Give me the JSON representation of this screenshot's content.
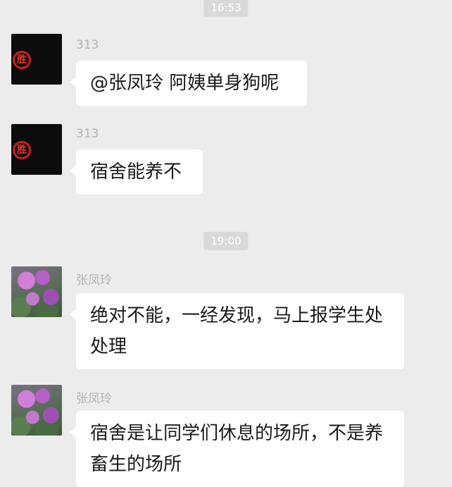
{
  "timestamps": [
    "16:53",
    "19:00"
  ],
  "messages": [
    {
      "sender": "313",
      "text": "@张凤玲 阿姨单身狗呢",
      "avatar": "seal-avatar"
    },
    {
      "sender": "313",
      "text": "宿舍能养不",
      "avatar": "seal-avatar"
    },
    {
      "sender": "张凤玲",
      "text": "绝对不能，一经发现，马上报学生处处理",
      "avatar": "flower-avatar"
    },
    {
      "sender": "张凤玲",
      "text": "宿舍是让同学们休息的场所，不是养畜生的场所",
      "avatar": "flower-avatar"
    }
  ],
  "avatar_seal_char": "胜"
}
